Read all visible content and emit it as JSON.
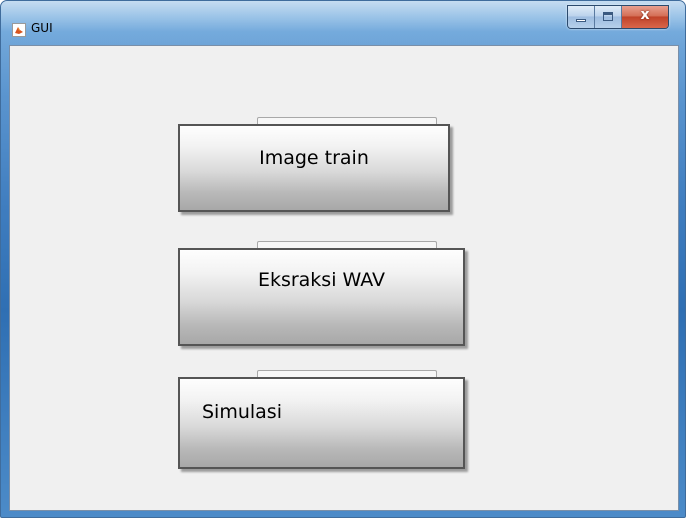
{
  "window": {
    "title": "GUI",
    "app_icon": "matlab-figure-icon",
    "caption_buttons": {
      "minimize_icon": "minimize-icon",
      "maximize_icon": "maximize-icon",
      "close_icon": "close-icon",
      "close_glyph": "x"
    }
  },
  "buttons": {
    "image_train": "Image train",
    "ekstraksi_wav": "Eksraksi WAV",
    "simulasi": "Simulasi"
  },
  "colors": {
    "client_background": "#f0f0f0",
    "close_button": "#c0432a",
    "titlebar": "#5b95cf"
  }
}
